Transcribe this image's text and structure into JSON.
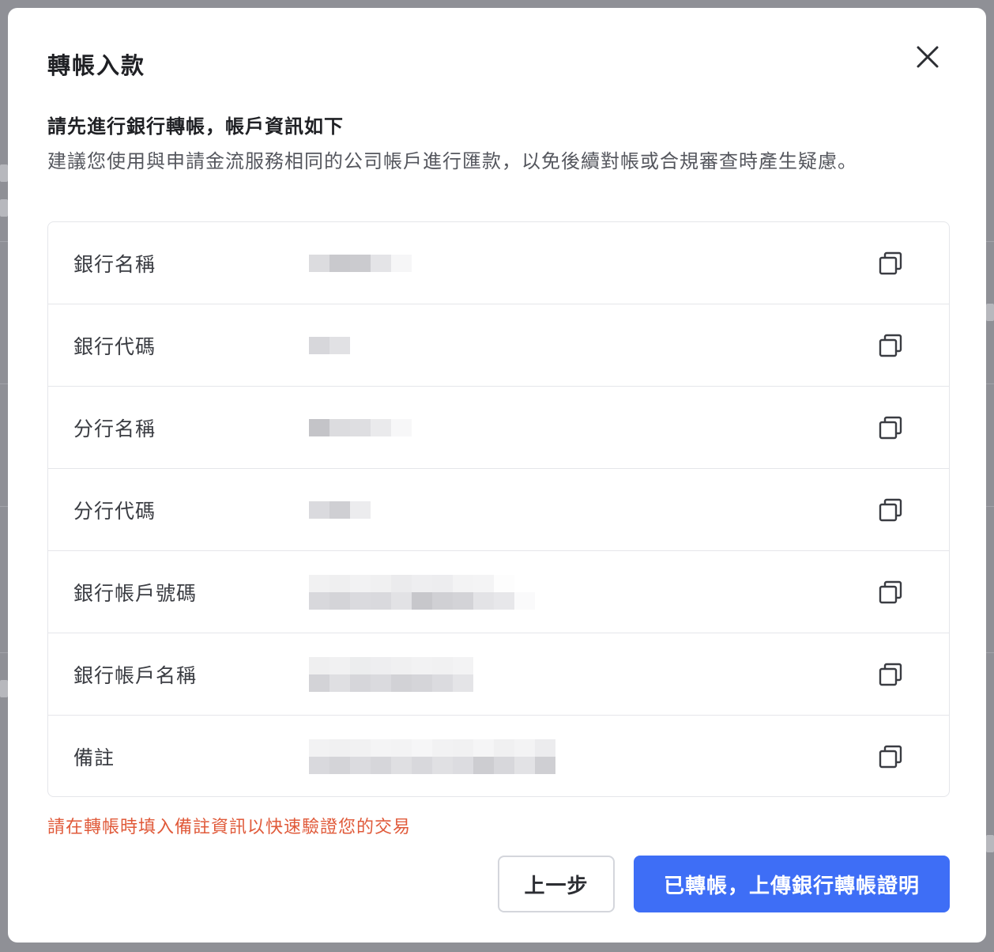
{
  "modal": {
    "title": "轉帳入款",
    "intro_heading": "請先進行銀行轉帳，帳戶資訊如下",
    "intro_description": "建議您使用與申請金流服務相同的公司帳戶進行匯款，以免後續對帳或合規審查時產生疑慮。",
    "rows": [
      {
        "label": "銀行名稱",
        "value": "(redacted)"
      },
      {
        "label": "銀行代碼",
        "value": "(redacted)"
      },
      {
        "label": "分行名稱",
        "value": "(redacted)"
      },
      {
        "label": "分行代碼",
        "value": "(redacted)"
      },
      {
        "label": "銀行帳戶號碼",
        "value": "(redacted)"
      },
      {
        "label": "銀行帳戶名稱",
        "value": "(redacted)"
      },
      {
        "label": "備註",
        "value": "(redacted)"
      }
    ],
    "note": "請在轉帳時填入備註資訊以快速驗證您的交易",
    "back_button": "上一步",
    "confirm_button": "已轉帳，上傳銀行轉帳證明"
  },
  "icons": {
    "close": "close-icon",
    "copy": "copy-icon"
  },
  "colors": {
    "primary": "#3e6ef6",
    "warning_text": "#e05a3a",
    "overlay": "#8f9096",
    "border": "#e5e6ea"
  }
}
